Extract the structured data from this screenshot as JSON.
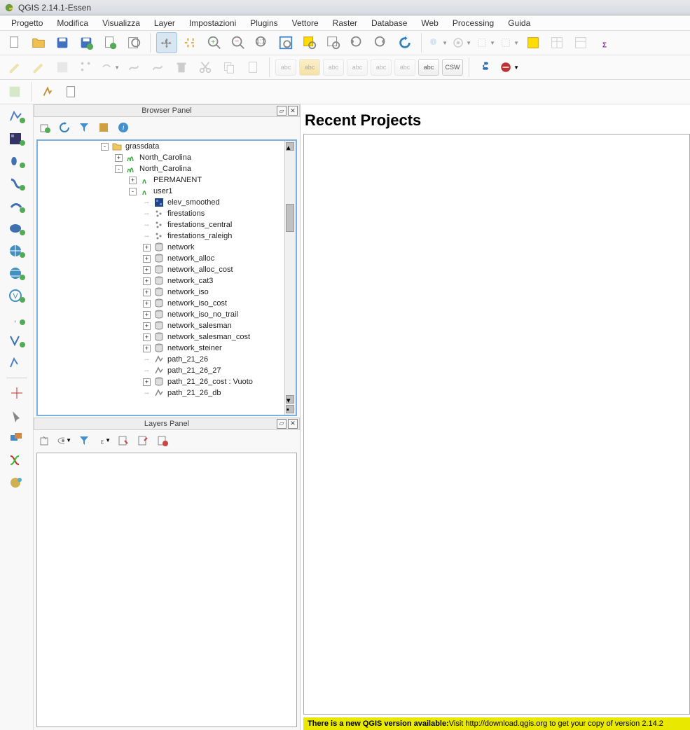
{
  "window": {
    "title": "QGIS 2.14.1-Essen"
  },
  "menu": [
    "Progetto",
    "Modifica",
    "Visualizza",
    "Layer",
    "Impostazioni",
    "Plugins",
    "Vettore",
    "Raster",
    "Database",
    "Web",
    "Processing",
    "Guida"
  ],
  "panels": {
    "browser": {
      "title": "Browser Panel",
      "tree": [
        {
          "indent": 9,
          "expand": "-",
          "icon": "folder",
          "label": "grassdata"
        },
        {
          "indent": 11,
          "expand": "+",
          "icon": "grass-loc",
          "label": "North_Carolina"
        },
        {
          "indent": 11,
          "expand": "-",
          "icon": "grass-loc",
          "label": "North_Carolina"
        },
        {
          "indent": 13,
          "expand": "+",
          "icon": "grass-mapset",
          "label": "PERMANENT"
        },
        {
          "indent": 13,
          "expand": "-",
          "icon": "grass-mapset",
          "label": "user1"
        },
        {
          "indent": 15,
          "expand": "",
          "icon": "raster",
          "label": "elev_smoothed"
        },
        {
          "indent": 15,
          "expand": "",
          "icon": "point",
          "label": "firestations"
        },
        {
          "indent": 15,
          "expand": "",
          "icon": "point",
          "label": "firestations_central"
        },
        {
          "indent": 15,
          "expand": "",
          "icon": "point",
          "label": "firestations_raleigh"
        },
        {
          "indent": 15,
          "expand": "+",
          "icon": "db",
          "label": "network"
        },
        {
          "indent": 15,
          "expand": "+",
          "icon": "db",
          "label": "network_alloc"
        },
        {
          "indent": 15,
          "expand": "+",
          "icon": "db",
          "label": "network_alloc_cost"
        },
        {
          "indent": 15,
          "expand": "+",
          "icon": "db",
          "label": "network_cat3"
        },
        {
          "indent": 15,
          "expand": "+",
          "icon": "db",
          "label": "network_iso"
        },
        {
          "indent": 15,
          "expand": "+",
          "icon": "db",
          "label": "network_iso_cost"
        },
        {
          "indent": 15,
          "expand": "+",
          "icon": "db",
          "label": "network_iso_no_trail"
        },
        {
          "indent": 15,
          "expand": "+",
          "icon": "db",
          "label": "network_salesman"
        },
        {
          "indent": 15,
          "expand": "+",
          "icon": "db",
          "label": "network_salesman_cost"
        },
        {
          "indent": 15,
          "expand": "+",
          "icon": "db",
          "label": "network_steiner"
        },
        {
          "indent": 15,
          "expand": "",
          "icon": "line",
          "label": "path_21_26"
        },
        {
          "indent": 15,
          "expand": "",
          "icon": "line",
          "label": "path_21_26_27"
        },
        {
          "indent": 15,
          "expand": "+",
          "icon": "db",
          "label": "path_21_26_cost : Vuoto"
        },
        {
          "indent": 15,
          "expand": "",
          "icon": "line",
          "label": "path_21_26_db"
        }
      ]
    },
    "layers": {
      "title": "Layers Panel"
    }
  },
  "content": {
    "recent_title": "Recent Projects"
  },
  "status": {
    "bold": "There is a new QGIS version available:",
    "rest": " Visit http://download.qgis.org to get your copy of version 2.14.2"
  },
  "abc_labels": [
    "abc",
    "abc",
    "abc",
    "abc",
    "abc",
    "abc",
    "abc",
    "CSW"
  ]
}
